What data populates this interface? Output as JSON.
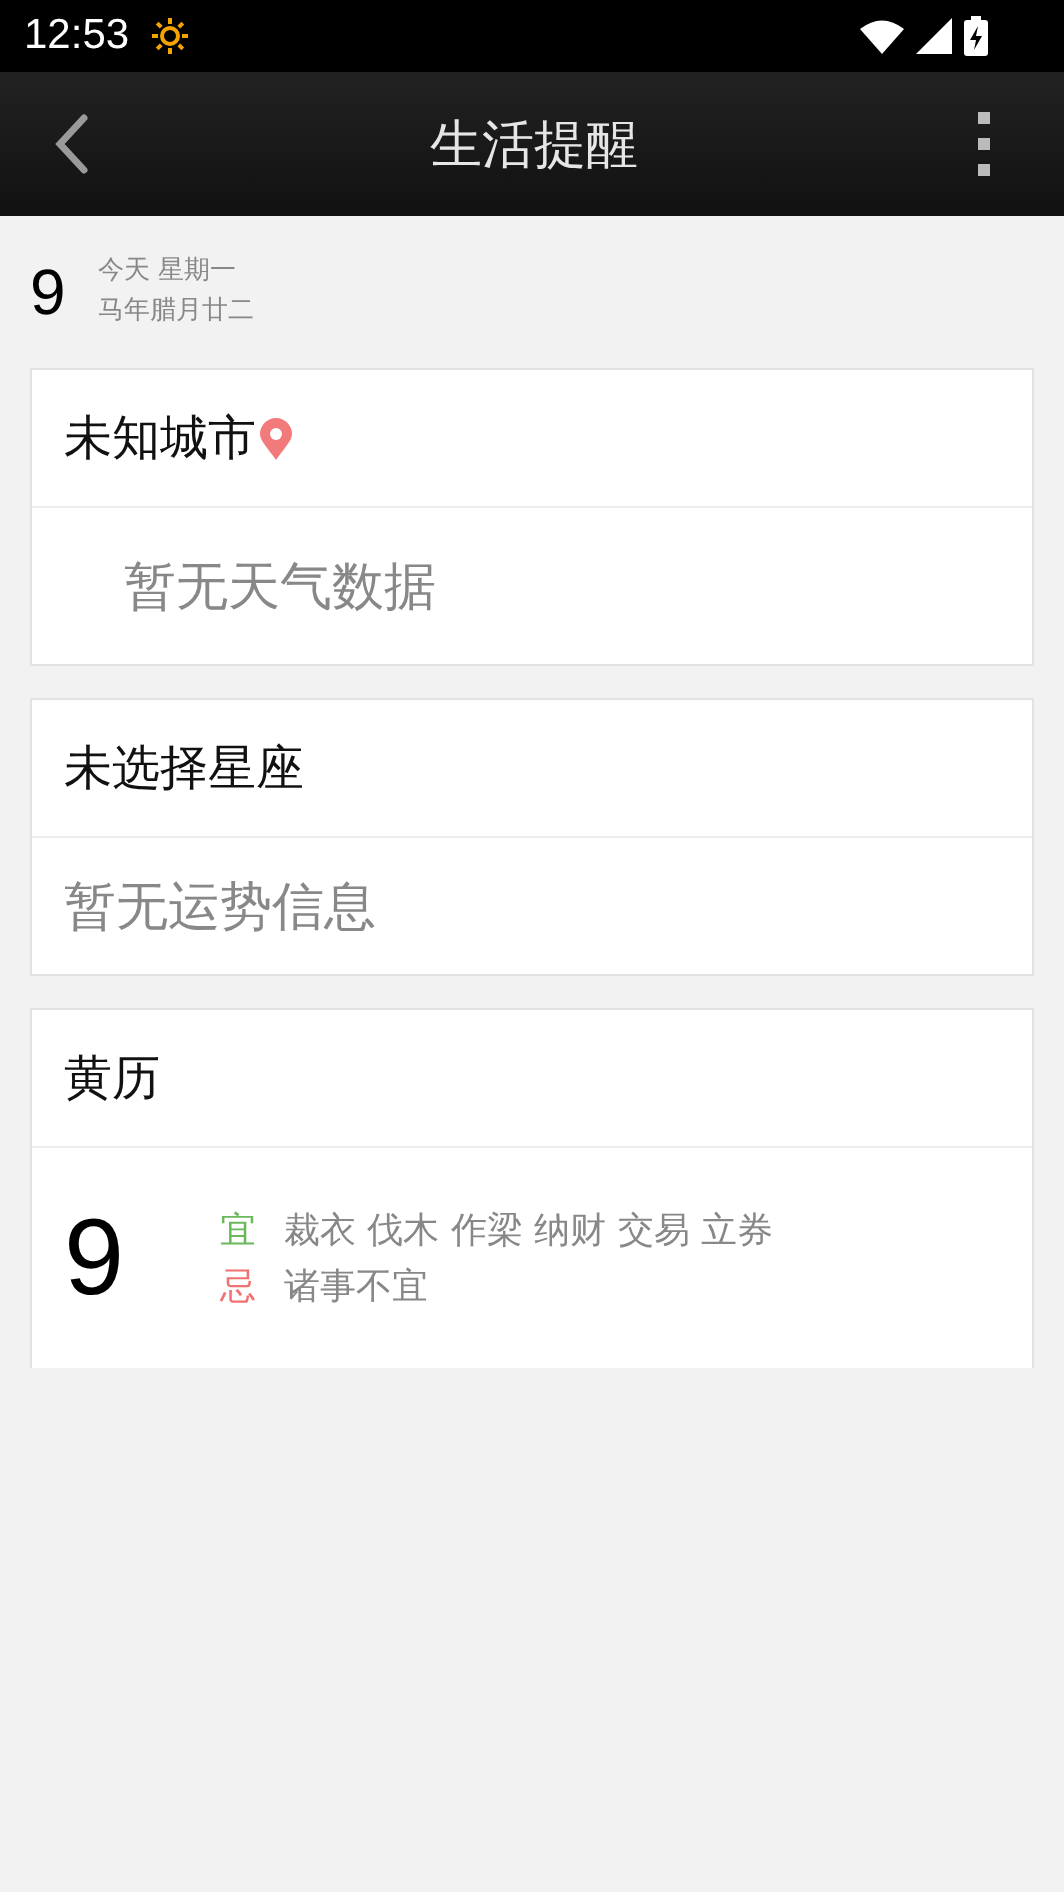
{
  "status_bar": {
    "time": "12:53"
  },
  "toolbar": {
    "title": "生活提醒"
  },
  "date": {
    "day": "9",
    "weekday": "今天 星期一",
    "lunar": "马年腊月廿二"
  },
  "weather_card": {
    "title": "未知城市",
    "message": "暂无天气数据"
  },
  "horoscope_card": {
    "title": "未选择星座",
    "message": "暂无运势信息"
  },
  "almanac_card": {
    "title": "黄历",
    "day": "9",
    "rows": [
      {
        "label": "宜",
        "color": "#6cb85c",
        "text": "裁衣 伐木 作梁 纳财 交易 立券"
      },
      {
        "label": "忌",
        "color": "#f07272",
        "text": "诸事不宜"
      }
    ]
  }
}
